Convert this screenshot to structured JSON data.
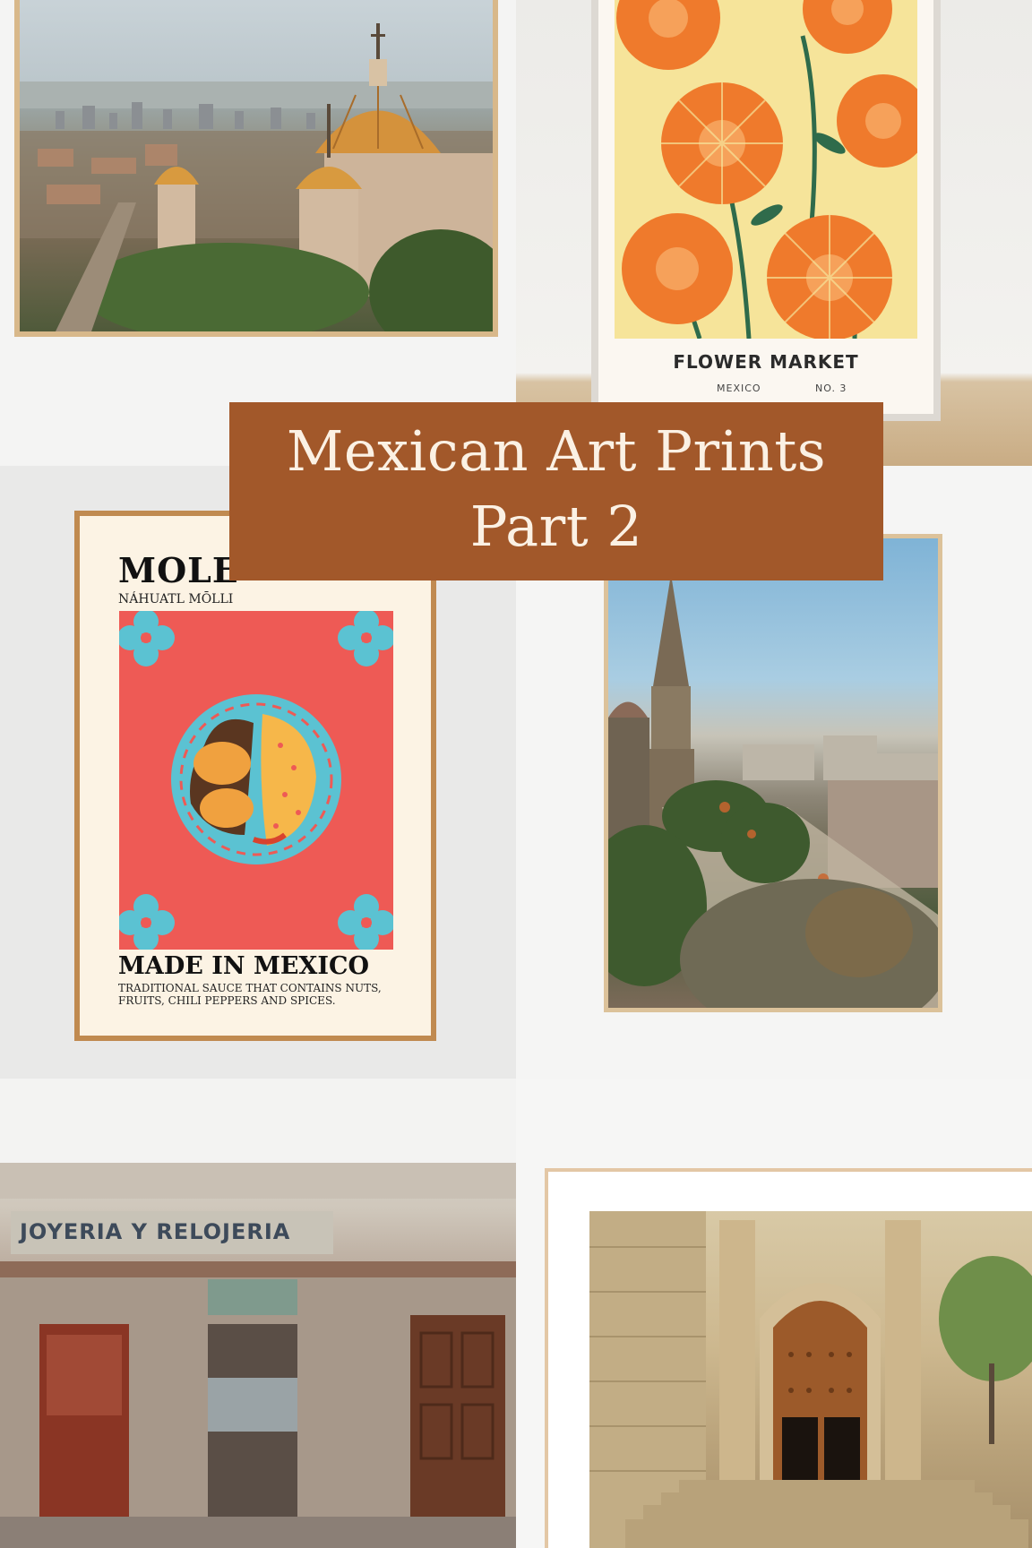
{
  "banner": {
    "line1": "Mexican Art Prints",
    "line2": "Part 2"
  },
  "flower_poster": {
    "title": "FLOWER MARKET",
    "place": "MEXICO",
    "number": "NO. 3"
  },
  "mole_poster": {
    "title": "MOLE",
    "subtitle": "NÁHUATL MŌLLI",
    "made": "MADE IN MEXICO",
    "description": "TRADITIONAL SAUCE THAT CONTAINS NUTS, FRUITS, CHILI PEPPERS AND SPICES."
  },
  "facade_photo": {
    "sign": "JOYERIA Y RELOJERIA"
  },
  "colors": {
    "banner": "#a2582a",
    "banner_text": "#fbf1e4",
    "poster_red": "#ee5a55",
    "tile_blue": "#5bc2d2",
    "flower_orange": "#ef7a2c",
    "flower_bg": "#f6e49a"
  }
}
